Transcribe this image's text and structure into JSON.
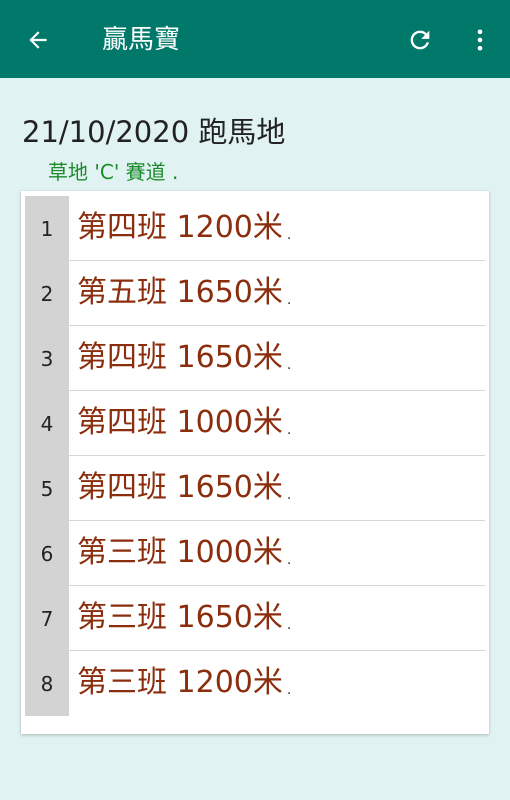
{
  "appbar": {
    "title": "贏馬寶",
    "back_icon": "arrow-back-icon",
    "refresh_icon": "refresh-icon",
    "more_icon": "more-vert-icon",
    "color": "#00796b"
  },
  "meeting": {
    "heading": "21/10/2020 跑馬地",
    "track": "草地 'C' 賽道 ."
  },
  "races": [
    {
      "number": "1",
      "label": "第四班 1200米",
      "dot": "."
    },
    {
      "number": "2",
      "label": "第五班 1650米",
      "dot": "."
    },
    {
      "number": "3",
      "label": "第四班 1650米",
      "dot": "."
    },
    {
      "number": "4",
      "label": "第四班 1000米",
      "dot": "."
    },
    {
      "number": "5",
      "label": "第四班 1650米",
      "dot": "."
    },
    {
      "number": "6",
      "label": "第三班 1000米",
      "dot": "."
    },
    {
      "number": "7",
      "label": "第三班 1650米",
      "dot": "."
    },
    {
      "number": "8",
      "label": "第三班 1200米",
      "dot": "."
    }
  ],
  "colors": {
    "background": "#e0f2f1",
    "race_text": "#8b2e0e",
    "track_text": "#1b8a2a"
  }
}
